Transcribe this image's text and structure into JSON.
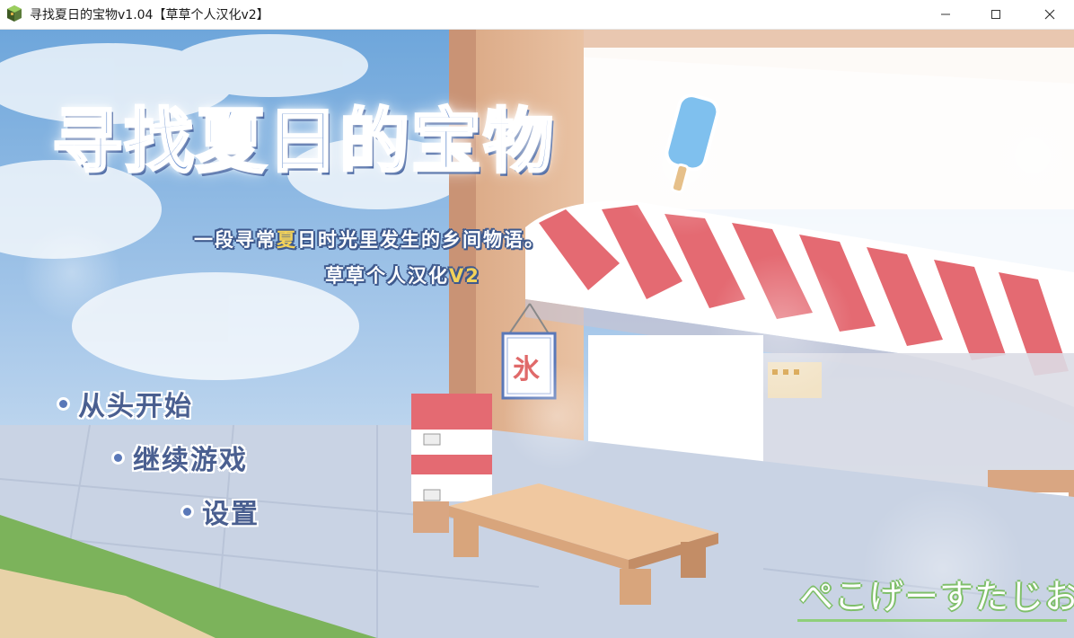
{
  "window": {
    "title": "寻找夏日的宝物v1.04【草草个人汉化v2】",
    "icon": "game-app-icon",
    "controls": [
      "minimize-icon",
      "maximize-icon",
      "close-icon"
    ]
  },
  "game": {
    "logo": "寻找夏日的宝物",
    "subtitle_pre": "一段寻常",
    "subtitle_hl": "夏",
    "subtitle_post": "日时光里发生的乡间物语。",
    "credit": "草草个人汉化",
    "credit_version": "V2",
    "sign_char": "氷",
    "brand": "ぺこげーすたじお"
  },
  "menu": {
    "new_game": "从头开始",
    "continue": "继续游戏",
    "settings": "设置"
  },
  "colors": {
    "sky": "#8fb8e4",
    "awning_red": "#e46a72",
    "awning_white": "#ffffff",
    "menu_text": "#4a5f90",
    "accent_yellow": "#f3d25a"
  }
}
